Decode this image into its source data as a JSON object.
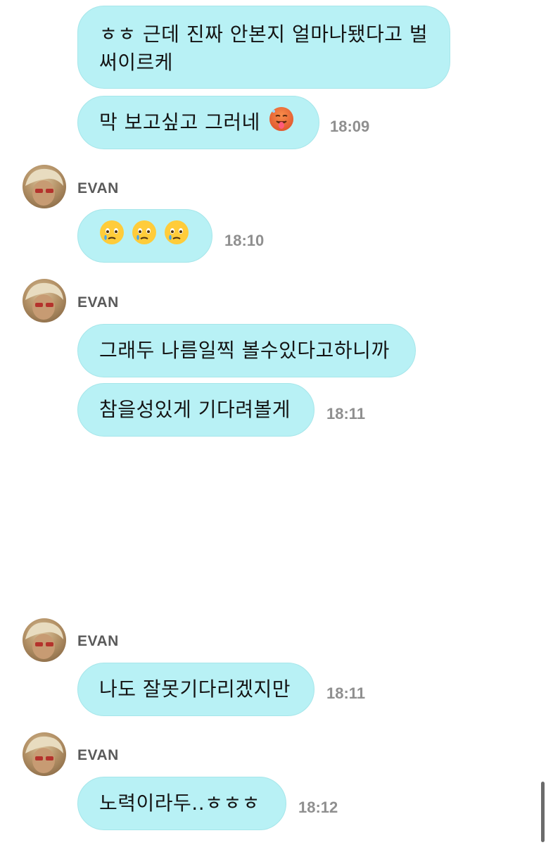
{
  "messages": [
    {
      "text_lines": [
        "ㅎㅎ 근데 진짜 안본지 얼마나됐다고 벌",
        "써이르케"
      ]
    },
    {
      "text": "막 보고싶고 그러네",
      "emoji": "hot-face-emoji",
      "time": "18:09"
    },
    {
      "sender": "EVAN",
      "emojis": [
        "holding-back-tears-emoji",
        "holding-back-tears-emoji",
        "holding-back-tears-emoji"
      ],
      "time": "18:10"
    },
    {
      "sender": "EVAN",
      "text": "그래두 나름일찍 볼수있다고하니까"
    },
    {
      "text": "참을성있게 기다려볼게",
      "time": "18:11"
    },
    {
      "sender": "EVAN",
      "text": "나도 잘못기다리겠지만",
      "time": "18:11"
    },
    {
      "sender": "EVAN",
      "text": "노력이라두..ㅎㅎㅎ",
      "time": "18:12"
    }
  ],
  "colors": {
    "bubble": "#b8f1f5",
    "time": "#8f8f8f",
    "name": "#5a5a5a"
  }
}
